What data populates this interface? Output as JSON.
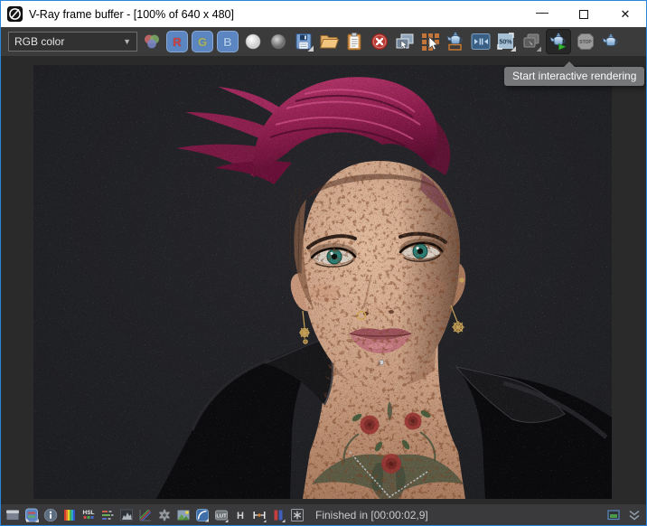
{
  "window": {
    "title": "V-Ray frame buffer - [100% of 640 x 480]",
    "controls": {
      "minimize_glyph": "—",
      "close_glyph": "✕"
    }
  },
  "toolbar": {
    "channel_dropdown": {
      "value": "RGB color"
    },
    "channel_buttons": [
      {
        "label": "R"
      },
      {
        "label": "G"
      },
      {
        "label": "B"
      }
    ],
    "test_resolution_label": "50%",
    "stop_label": "STOP",
    "icons": [
      "rgb-channels",
      "red-channel",
      "green-channel",
      "blue-channel",
      "alpha-channel",
      "monochromatic",
      "save-image",
      "load-image",
      "copy-to-clipboard",
      "clear-image",
      "duplicate-to-host-frame-buffer",
      "track-mouse-while-rendering",
      "region-render",
      "compare",
      "test-resolution-50",
      "render-history",
      "start-interactive-rendering",
      "stop-rendering",
      "render-last"
    ]
  },
  "tooltip": {
    "text": "Start interactive rendering"
  },
  "corrections_bar": {
    "hsl_label": "HSL",
    "lut_label": "LUT",
    "history_label": "H",
    "icons": [
      "show-corrections-control",
      "color-corrections",
      "pixel-information",
      "force-color-clamping",
      "hsl-correction",
      "color-balance",
      "levels",
      "curve-correction",
      "exposure",
      "white-balance",
      "srgb",
      "lut",
      "render-history",
      "icc-profile",
      "stereo",
      "ocio"
    ]
  },
  "status_bar": {
    "text": "Finished in [00:00:02,9]"
  },
  "render": {
    "subject": "female punk character portrait: magenta swept mohawk, shaved sides, freckled skin, green eyes, gold nose ring, spiked earrings, labret stud, red rose neck tattoos, silver chain, black leather jacket, noisy interactive render on dark background"
  },
  "colors": {
    "window_border": "#2a86dd",
    "titlebar_bg": "#ffffff",
    "toolbar_bg": "#3b3b3b",
    "viewer_bg": "#2a2a2a",
    "render_bg": "#1f2023",
    "status_bg": "#3a3a3d",
    "channel_button_bg": "#5b86c2",
    "tooltip_bg": "#767779",
    "hair_accent": "#9c2558",
    "rose_tattoo": "#9c3636"
  }
}
